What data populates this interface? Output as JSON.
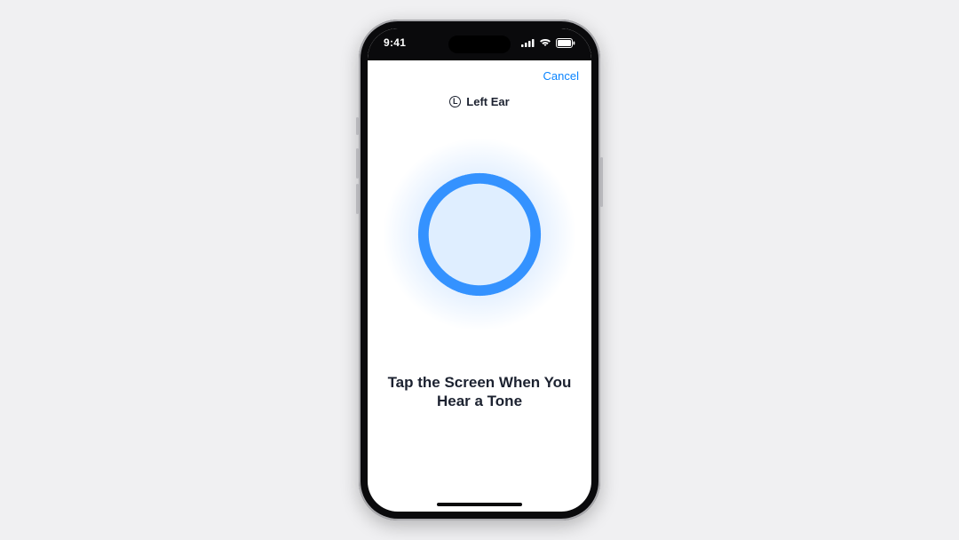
{
  "status": {
    "time": "9:41"
  },
  "nav": {
    "cancel_label": "Cancel"
  },
  "ear": {
    "indicator_letter": "L",
    "label": "Left Ear"
  },
  "instruction": {
    "line1": "Tap the Screen When You",
    "line2": "Hear a Tone"
  },
  "colors": {
    "accent_blue": "#2a8cff",
    "cancel_blue": "#0a84ff",
    "text_dark": "#1c2230"
  }
}
